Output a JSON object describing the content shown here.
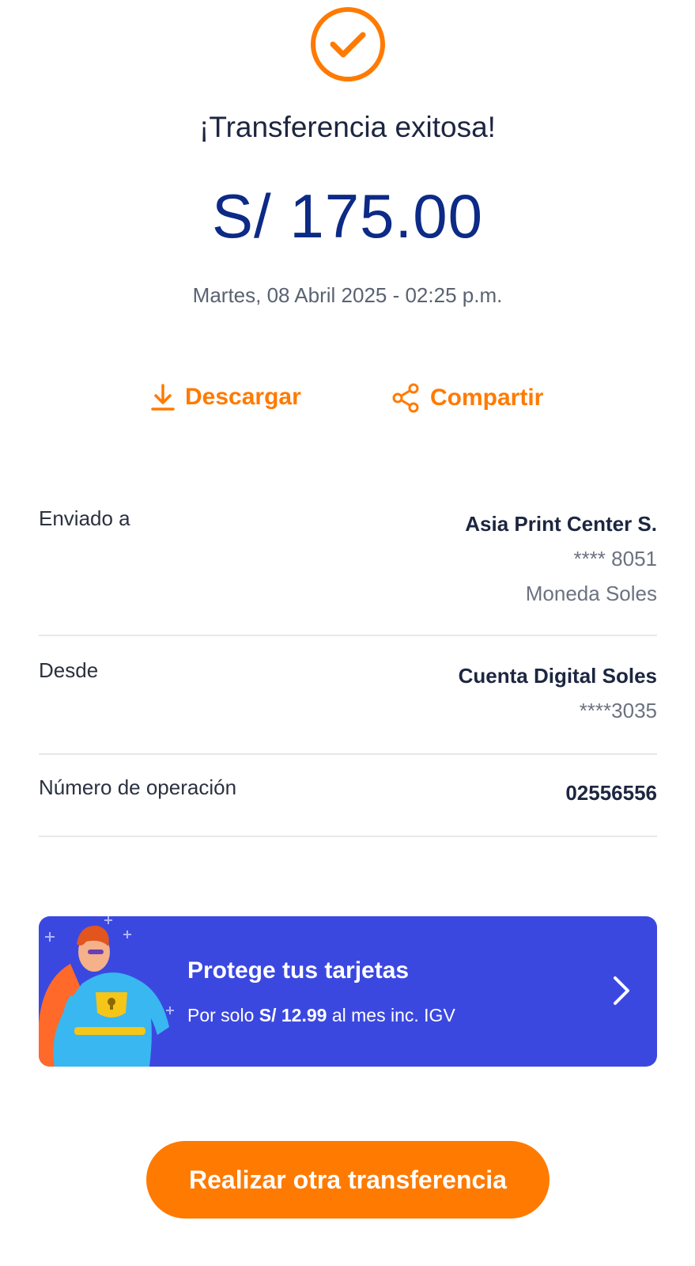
{
  "header": {
    "status_icon": "check-circle-icon",
    "title": "¡Transferencia exitosa!",
    "amount": "S/ 175.00",
    "datetime": "Martes, 08 Abril 2025 - 02:25 p.m."
  },
  "actions": {
    "download": {
      "icon": "download-icon",
      "label": "Descargar"
    },
    "share": {
      "icon": "share-icon",
      "label": "Compartir"
    }
  },
  "details": {
    "sent_to": {
      "label": "Enviado a",
      "name": "Asia Print Center S.",
      "account": "**** 8051",
      "currency": "Moneda Soles"
    },
    "from": {
      "label": "Desde",
      "account_name": "Cuenta Digital Soles",
      "account": "****3035"
    },
    "operation": {
      "label": "Número de operación",
      "number": "02556556"
    }
  },
  "promo": {
    "title": "Protege tus tarjetas",
    "subtitle_prefix": "Por solo ",
    "price": "S/ 12.99",
    "subtitle_suffix": " al mes inc. IGV",
    "icon": "chevron-right-icon"
  },
  "cta": {
    "label": "Realizar otra transferencia"
  },
  "colors": {
    "accent": "#ff7a00",
    "amount": "#0c2a86",
    "promo_bg": "#3b48e0"
  }
}
